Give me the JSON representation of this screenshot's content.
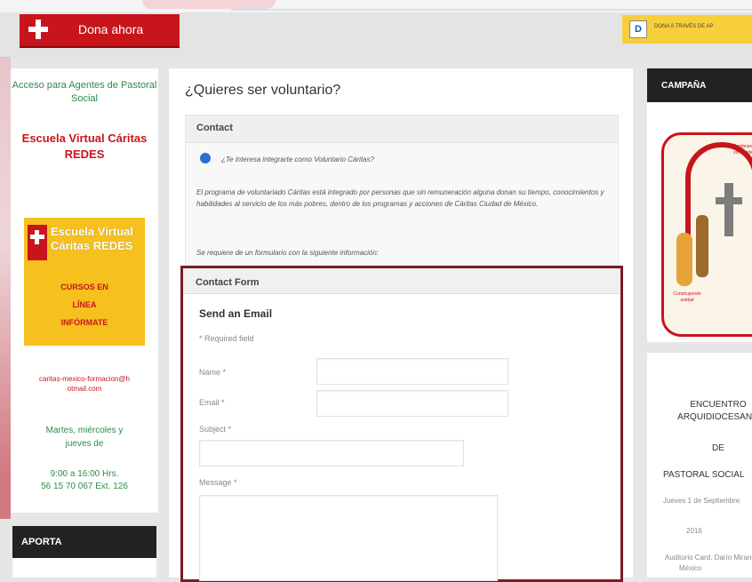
{
  "header": {
    "donate_label": "Dona ahora",
    "right_banner_letter": "D",
    "right_banner_text": "DONA A TRAVÉS DE AP"
  },
  "left_sidebar": {
    "agents_link": "Acceso para Agentes de Pastoral Social",
    "school_link": "Escuela Virtual Cáritas REDES",
    "promo": {
      "brand": "Escuela Virtual Cáritas REDES",
      "lines": [
        "CURSOS EN",
        "LÍNEA",
        "INFÓRMATE"
      ]
    },
    "email": "caritas-mexico-formacion@hotmail.com",
    "days": "Martes, miércoles y jueves de",
    "hours": "9:00 a 16:00 Hrs.",
    "phone": "56 15 70 067 Ext. 126",
    "aporta": "APORTA"
  },
  "main": {
    "title": "¿Quieres ser voluntario?",
    "contact": {
      "header": "Contact",
      "question": "¿Te interesa integrarte como Voluntario Cáritas?",
      "paragraph": "El programa de voluntariado Cáritas está integrado por personas que sin remuneración alguna donan su tiempo, conocimientos y habilidades al servicio de los más pobres, dentro de los programas y acciones de Cáritas Ciudad de México.",
      "requirement": "Se requiere de un formulario con la siguiente información:"
    },
    "contact_form": {
      "header": "Contact Form",
      "send_title": "Send an Email",
      "required_note": "* Required field",
      "name_label": "Name *",
      "email_label": "Email *",
      "subject_label": "Subject *",
      "message_label": "Message *"
    }
  },
  "right_column": {
    "campaign_header": "CAMPAÑA",
    "poster_top": "Sembrando comunidad",
    "poster_bottom": "Construyendo unidad",
    "event_line1": "ENCUENTRO",
    "event_line2": "ARQUIDIOCESANO",
    "event_de": "DE",
    "event_line3": "PASTORAL SOCIAL",
    "event_date": "Jueves 1 de Septiembre",
    "event_year": "2016",
    "event_place": "Auditorio Card. Darío Miranda",
    "event_place2": "México"
  }
}
